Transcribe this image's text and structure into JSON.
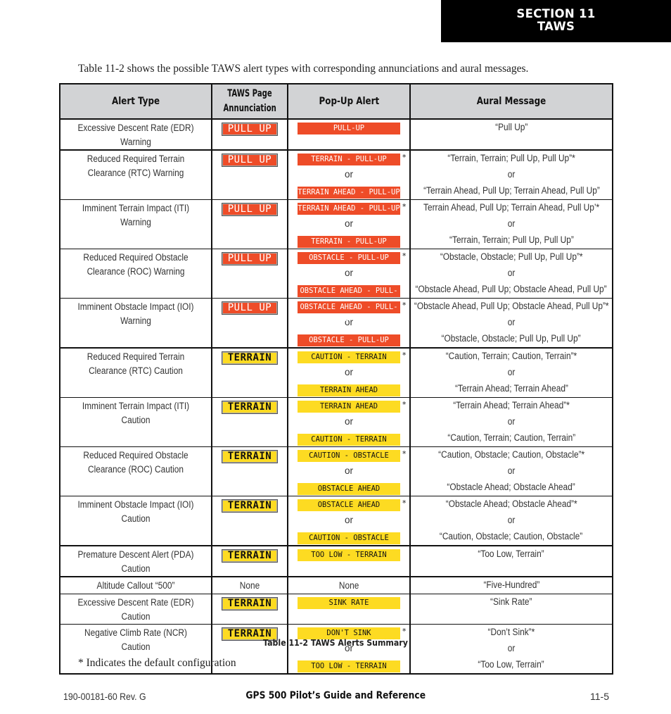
{
  "section": {
    "line1": "SECTION 11",
    "line2": "TAWS"
  },
  "intro": "Table 11-2 shows the possible TAWS alert types with corresponding annunciations and aural messages.",
  "table": {
    "headers": [
      "Alert Type",
      "TAWS Page Annunciation",
      "Pop-Up Alert",
      "Aural Message"
    ],
    "header_annunciation_line1": "TAWS Page",
    "header_annunciation_line2": "Annunciation",
    "or_label": "or",
    "colors": {
      "warning": "#ee4c28",
      "caution": "#fddb22"
    },
    "rows": [
      {
        "type": "Excessive Descent Rate (EDR) Warning",
        "annunciation": "PULL UP",
        "level": "warn",
        "popups": [
          {
            "text": "PULL-UP",
            "star": ""
          }
        ],
        "aural": [
          "“Pull Up”"
        ]
      },
      {
        "type": "Reduced Required Terrain Clearance (RTC) Warning",
        "annunciation": "PULL UP",
        "level": "warn",
        "popups": [
          {
            "text": "TERRAIN - PULL-UP",
            "star": "*"
          },
          {
            "text": "TERRAIN AHEAD - PULL-UP",
            "star": ""
          }
        ],
        "aural": [
          "“Terrain, Terrain; Pull Up, Pull Up”*",
          "or",
          "“Terrain Ahead, Pull Up; Terrain Ahead, Pull Up”"
        ]
      },
      {
        "type": "Imminent Terrain Impact (ITI) Warning",
        "annunciation": "PULL UP",
        "level": "warn",
        "popups": [
          {
            "text": "TERRAIN AHEAD - PULL-UP",
            "star": "*"
          },
          {
            "text": "TERRAIN - PULL-UP",
            "star": ""
          }
        ],
        "aural": [
          "Terrain Ahead, Pull Up; Terrain Ahead, Pull Up’*",
          "or",
          "“Terrain, Terrain; Pull Up, Pull Up”"
        ]
      },
      {
        "type": "Reduced Required Obstacle Clearance (ROC) Warning",
        "annunciation": "PULL UP",
        "level": "warn",
        "popups": [
          {
            "text": "OBSTACLE - PULL-UP",
            "star": "*"
          },
          {
            "text": "OBSTACLE AHEAD - PULL-UP",
            "star": ""
          }
        ],
        "aural": [
          "“Obstacle, Obstacle; Pull Up, Pull Up”*",
          "or",
          "“Obstacle Ahead, Pull Up; Obstacle Ahead, Pull Up”"
        ]
      },
      {
        "type": "Imminent Obstacle Impact (IOI) Warning",
        "annunciation": "PULL UP",
        "level": "warn",
        "popups": [
          {
            "text": "OBSTACLE AHEAD - PULL-UP",
            "star": "*"
          },
          {
            "text": "OBSTACLE - PULL-UP",
            "star": ""
          }
        ],
        "aural": [
          "“Obstacle Ahead, Pull Up; Obstacle Ahead, Pull Up”*",
          "or",
          "“Obstacle, Obstacle; Pull Up, Pull Up”"
        ]
      },
      {
        "type": "Reduced Required Terrain Clearance (RTC) Caution",
        "annunciation": "TERRAIN",
        "level": "caution",
        "popups": [
          {
            "text": "CAUTION - TERRAIN",
            "star": "*"
          },
          {
            "text": "TERRAIN AHEAD",
            "star": ""
          }
        ],
        "aural": [
          "“Caution, Terrain; Caution, Terrain”*",
          "or",
          "“Terrain Ahead; Terrain Ahead”"
        ]
      },
      {
        "type": "Imminent Terrain Impact (ITI) Caution",
        "annunciation": "TERRAIN",
        "level": "caution",
        "popups": [
          {
            "text": "TERRAIN AHEAD",
            "star": "*"
          },
          {
            "text": "CAUTION - TERRAIN",
            "star": ""
          }
        ],
        "aural": [
          "“Terrain Ahead; Terrain Ahead”*",
          "or",
          "“Caution, Terrain; Caution, Terrain”"
        ]
      },
      {
        "type": "Reduced Required Obstacle Clearance (ROC) Caution",
        "annunciation": "TERRAIN",
        "level": "caution",
        "popups": [
          {
            "text": "CAUTION - OBSTACLE",
            "star": "*"
          },
          {
            "text": "OBSTACLE AHEAD",
            "star": ""
          }
        ],
        "aural": [
          "“Caution, Obstacle; Caution, Obstacle”*",
          "or",
          "“Obstacle Ahead; Obstacle Ahead”"
        ]
      },
      {
        "type": "Imminent Obstacle Impact (IOI) Caution",
        "annunciation": "TERRAIN",
        "level": "caution",
        "popups": [
          {
            "text": "OBSTACLE AHEAD",
            "star": "*"
          },
          {
            "text": "CAUTION - OBSTACLE",
            "star": ""
          }
        ],
        "aural": [
          "“Obstacle Ahead; Obstacle Ahead”*",
          "or",
          "“Caution, Obstacle; Caution, Obstacle”"
        ]
      },
      {
        "type": "Premature Descent Alert (PDA) Caution",
        "annunciation": "TERRAIN",
        "level": "caution",
        "popups": [
          {
            "text": "TOO LOW - TERRAIN",
            "star": ""
          }
        ],
        "aural": [
          "“Too Low, Terrain”"
        ]
      },
      {
        "type": "Altitude Callout “500”",
        "annunciation": "None",
        "level": "none",
        "popups": [
          {
            "text": "None",
            "star": "",
            "plain": true
          }
        ],
        "aural": [
          "“Five-Hundred”"
        ]
      },
      {
        "type": "Excessive Descent Rate (EDR) Caution",
        "annunciation": "TERRAIN",
        "level": "caution",
        "popups": [
          {
            "text": "SINK RATE",
            "star": ""
          }
        ],
        "aural": [
          "“Sink Rate”"
        ]
      },
      {
        "type": "Negative Climb Rate (NCR) Caution",
        "annunciation": "TERRAIN",
        "level": "caution",
        "popups": [
          {
            "text": "DON'T SINK",
            "star": "*"
          },
          {
            "text": "TOO LOW - TERRAIN",
            "star": ""
          }
        ],
        "aural": [
          "“Don’t Sink”*",
          "or",
          "“Too Low, Terrain”"
        ]
      }
    ]
  },
  "caption": "Table 11-2  TAWS Alerts Summary",
  "footnote": "* Indicates the default configuration",
  "footer": {
    "left": "190-00181-60  Rev. G",
    "center": "GPS 500 Pilot’s Guide and Reference",
    "right": "11-5"
  }
}
